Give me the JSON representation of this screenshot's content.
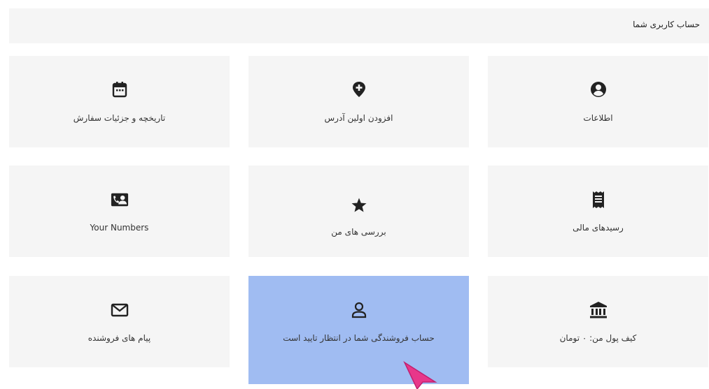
{
  "header": {
    "title": "حساب کاربری شما"
  },
  "cards": [
    {
      "label": "تاریخچه و جزئیات سفارش",
      "icon": "calendar-icon"
    },
    {
      "label": "افزودن اولین آدرس",
      "icon": "map-pin-plus-icon"
    },
    {
      "label": "اطلاعات",
      "icon": "user-circle-icon"
    },
    {
      "label": "Your Numbers",
      "icon": "contact-card-icon"
    },
    {
      "label": "بررسی های من",
      "icon": "star-icon"
    },
    {
      "label": "رسیدهای مالی",
      "icon": "receipt-icon"
    },
    {
      "label": "پیام های فروشنده",
      "icon": "envelope-icon"
    },
    {
      "label": "حساب فروشندگی شما در انتظار تایید است",
      "icon": "user-outline-icon"
    },
    {
      "label": "کیف پول من: ۰ تومان",
      "icon": "bank-icon"
    }
  ],
  "colors": {
    "card_bg": "#f5f5f5",
    "active_bg": "#a0bcf2",
    "cursor": "#e8378a"
  }
}
